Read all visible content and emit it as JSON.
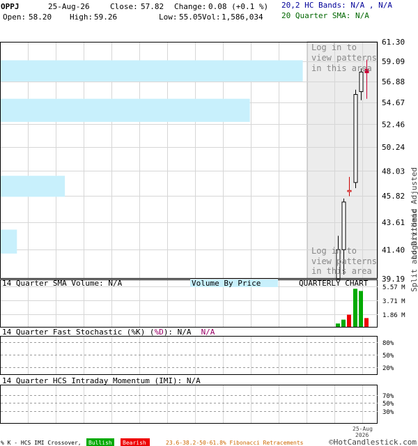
{
  "header": {
    "symbol": "OPPJ",
    "date": "25-Aug-26",
    "close_label": "Close:",
    "close": "57.82",
    "change_label": "Change:",
    "change": "0.08 (+0.1 %)",
    "open_label": "Open:",
    "open": "58.20",
    "high_label": "High:",
    "high": "59.26",
    "low_label": "Low:",
    "low": "55.05",
    "vol_label": "Vol:",
    "vol": "1,586,034",
    "bands_label": "20,2 HC Bands: N/A , N/A",
    "sma_label": "20 Quarter SMA: N/A"
  },
  "price_panel": {
    "right_title_top": "Split and Dividend Adjusted",
    "right_title_bottom": "Logarithmic",
    "login_top": [
      "Log in to",
      "view patterns",
      "in this area"
    ],
    "login_bottom": [
      "Log in to",
      "view patterns",
      "in this area"
    ]
  },
  "volume_panel": {
    "label": "14 Quarter SMA Volume: N/A",
    "vbp_label": "Volume By Price",
    "chart_label": "QUARTERLY CHART",
    "ticks": [
      "5.57 M",
      "3.71 M",
      "1.86 M"
    ]
  },
  "stoch_panel": {
    "label_prefix": "14 Quarter Fast Stochastic (",
    "k_label": "%K",
    "mid": ") (",
    "d_label": "%D",
    "label_suffix": "): N/A",
    "na_d": "N/A",
    "ticks": [
      "80%",
      "50%",
      "20%"
    ]
  },
  "imi_panel": {
    "label": "14 Quarter HCS Intraday Momentum (IMI): N/A",
    "ticks": [
      "70%",
      "50%",
      "30%"
    ]
  },
  "x_axis": {
    "date_label": "25-Aug",
    "year_label": "2026"
  },
  "footer": {
    "legend_prefix": "% K - HCS IMI Crossover,",
    "bullish": "Bullish",
    "bearish": "Bearish",
    "fib": "23.6-38.2-50-61.8% Fibonacci Retracements",
    "brand": "©HotCandlestick.com"
  },
  "colors": {
    "up": "#000000",
    "down": "#cc0000",
    "last": "#cc0033",
    "volume_up": "#00aa00",
    "volume_down": "#ee0000",
    "vbp": "#c8f0fc",
    "stoch_d": "#990066",
    "bands": "#000099",
    "sma": "#006600",
    "fib": "#cc6600"
  },
  "chart_data": {
    "type": "candlestick",
    "scale": "log",
    "ylim": [
      39.19,
      61.3
    ],
    "y_ticks": [
      "61.30",
      "59.09",
      "56.88",
      "54.67",
      "52.46",
      "50.24",
      "48.03",
      "45.82",
      "43.61",
      "41.40",
      "39.19"
    ],
    "ohlc": [
      {
        "open": 39.19,
        "high": 42.5,
        "low": 39.19,
        "close": 41.4
      },
      {
        "open": 41.4,
        "high": 45.6,
        "low": 39.5,
        "close": 45.3
      },
      {
        "open": 46.3,
        "high": 47.5,
        "low": 45.8,
        "close": 46.2
      },
      {
        "open": 47.0,
        "high": 56.0,
        "low": 46.5,
        "close": 55.5
      },
      {
        "open": 55.8,
        "high": 58.3,
        "low": 54.9,
        "close": 57.9
      },
      {
        "open": 58.2,
        "high": 59.26,
        "low": 55.05,
        "close": 57.82
      }
    ],
    "volume_by_price": [
      {
        "price_low": 56.88,
        "price_high": 59.2,
        "relative": 0.8
      },
      {
        "price_low": 52.7,
        "price_high": 55.05,
        "relative": 0.66
      },
      {
        "price_low": 45.75,
        "price_high": 47.6,
        "relative": 0.17
      },
      {
        "price_low": 41.1,
        "price_high": 43.0,
        "relative": 0.043
      }
    ],
    "volume_millions": [
      0.6,
      1.3,
      2.2,
      6.9,
      6.5,
      1.586
    ],
    "volume_ylim": [
      0,
      7.2
    ]
  }
}
